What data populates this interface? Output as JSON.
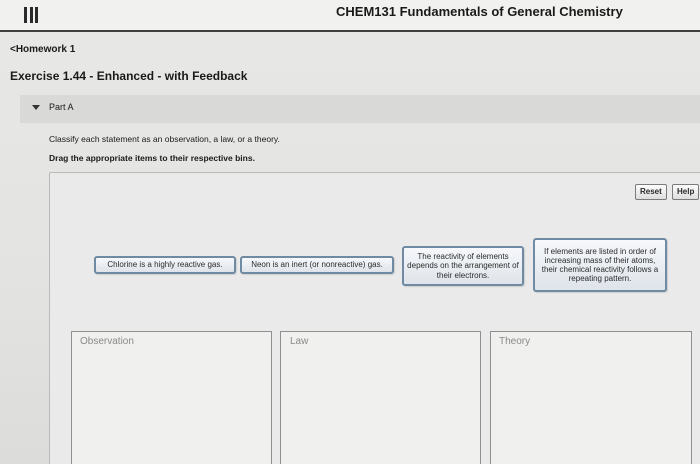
{
  "header": {
    "menu_icon": "hamburger-menu-icon",
    "title": "CHEM131 Fundamentals of General Chemistry"
  },
  "breadcrumb": {
    "label": "<Homework 1"
  },
  "exercise": {
    "title": "Exercise 1.44 - Enhanced - with Feedback"
  },
  "part": {
    "label": "Part A",
    "caret_icon": "caret-down-icon"
  },
  "instructions": {
    "line1": "Classify each statement as an observation, a law, or a theory.",
    "line2": "Drag the appropriate items to their respective bins."
  },
  "toolbar": {
    "reset_label": "Reset",
    "help_label": "Help"
  },
  "items": [
    {
      "text": "Chlorine is a highly reactive gas."
    },
    {
      "text": "Neon is an inert (or nonreactive) gas."
    },
    {
      "text": "The reactivity of elements depends on the arrangement of their electrons."
    },
    {
      "text": "If elements are listed in order of increasing mass of their atoms, their chemical reactivity follows a repeating pattern."
    }
  ],
  "bins": [
    {
      "label": "Observation"
    },
    {
      "label": "Law"
    },
    {
      "label": "Theory"
    }
  ],
  "colors": {
    "item_border": "#6f8aa3",
    "background": "#e8e8e6",
    "header_rule": "#404040"
  }
}
